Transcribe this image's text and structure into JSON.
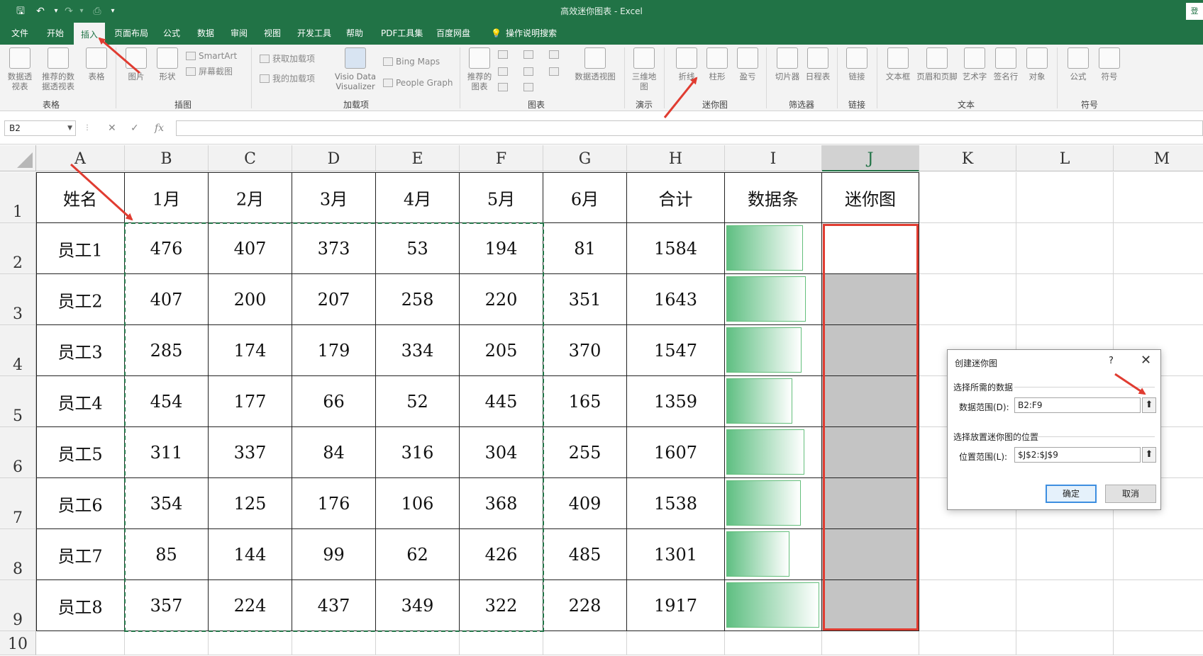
{
  "window": {
    "title": "高效迷你图表 - Excel",
    "login": "登"
  },
  "tabs": [
    {
      "label": "文件"
    },
    {
      "label": "开始"
    },
    {
      "label": "插入"
    },
    {
      "label": "页面布局"
    },
    {
      "label": "公式"
    },
    {
      "label": "数据"
    },
    {
      "label": "审阅"
    },
    {
      "label": "视图"
    },
    {
      "label": "开发工具"
    },
    {
      "label": "帮助"
    },
    {
      "label": "PDF工具集"
    },
    {
      "label": "百度网盘"
    },
    {
      "label": "操作说明搜索"
    }
  ],
  "ribbon": {
    "tables": {
      "pivot": "数据透视表",
      "recommended": "推荐的数据透视表",
      "table": "表格",
      "group": "表格"
    },
    "illustrations": {
      "pictures": "图片",
      "shapes": "形状",
      "smartart": "SmartArt",
      "screenshot": "屏幕截图",
      "group": "插图"
    },
    "addins": {
      "get": "获取加载项",
      "my": "我的加载项",
      "visio": "Visio Data Visualizer",
      "bing": "Bing Maps",
      "people": "People Graph",
      "group": "加载项"
    },
    "charts": {
      "recommended": "推荐的图表",
      "pivotchart": "数据透视图",
      "group": "图表"
    },
    "tours": {
      "map3d": "三维地图",
      "group": "演示"
    },
    "sparklines": {
      "line": "折线",
      "column": "柱形",
      "winloss": "盈亏",
      "group": "迷你图"
    },
    "filters": {
      "slicer": "切片器",
      "timeline": "日程表",
      "group": "筛选器"
    },
    "links": {
      "link": "链接",
      "group": "链接"
    },
    "text": {
      "textbox": "文本框",
      "headerfooter": "页眉和页脚",
      "wordart": "艺术字",
      "signature": "签名行",
      "object": "对象",
      "group": "文本"
    },
    "symbols": {
      "equation": "公式",
      "symbol": "符号",
      "group": "符号"
    }
  },
  "formula_bar": {
    "name_box": "B2",
    "formula": ""
  },
  "columns": [
    "A",
    "B",
    "C",
    "D",
    "E",
    "F",
    "G",
    "H",
    "I",
    "J",
    "K",
    "L",
    "M"
  ],
  "rows": [
    "1",
    "2",
    "3",
    "4",
    "5",
    "6",
    "7",
    "8",
    "9",
    "10"
  ],
  "table": {
    "headers": [
      "姓名",
      "1月",
      "2月",
      "3月",
      "4月",
      "5月",
      "6月",
      "合计",
      "数据条",
      "迷你图"
    ],
    "rows": [
      {
        "name": "员工1",
        "values": [
          "476",
          "407",
          "373",
          "53",
          "194",
          "81"
        ],
        "total": "1584",
        "bar_fraction": 0.826
      },
      {
        "name": "员工2",
        "values": [
          "407",
          "200",
          "207",
          "258",
          "220",
          "351"
        ],
        "total": "1643",
        "bar_fraction": 0.857
      },
      {
        "name": "员工3",
        "values": [
          "285",
          "174",
          "179",
          "334",
          "205",
          "370"
        ],
        "total": "1547",
        "bar_fraction": 0.807
      },
      {
        "name": "员工4",
        "values": [
          "454",
          "177",
          "66",
          "52",
          "445",
          "165"
        ],
        "total": "1359",
        "bar_fraction": 0.709
      },
      {
        "name": "员工5",
        "values": [
          "311",
          "337",
          "84",
          "316",
          "304",
          "255"
        ],
        "total": "1607",
        "bar_fraction": 0.838
      },
      {
        "name": "员工6",
        "values": [
          "354",
          "125",
          "176",
          "106",
          "368",
          "409"
        ],
        "total": "1538",
        "bar_fraction": 0.802
      },
      {
        "name": "员工7",
        "values": [
          "85",
          "144",
          "99",
          "62",
          "426",
          "485"
        ],
        "total": "1301",
        "bar_fraction": 0.679
      },
      {
        "name": "员工8",
        "values": [
          "357",
          "224",
          "437",
          "349",
          "322",
          "228"
        ],
        "total": "1917",
        "bar_fraction": 1.0
      }
    ]
  },
  "dialog": {
    "title": "创建迷你图",
    "help": "?",
    "close": "✕",
    "section_data": "选择所需的数据",
    "data_range_label": "数据范围(D):",
    "data_range_value": "B2:F9",
    "section_location": "选择放置迷你图的位置",
    "location_label": "位置范围(L):",
    "location_value": "$J$2:$J$9",
    "ok": "确定",
    "cancel": "取消"
  },
  "colors": {
    "accent": "#217346",
    "annotation": "#e03c31",
    "databar": "#63be7b"
  }
}
